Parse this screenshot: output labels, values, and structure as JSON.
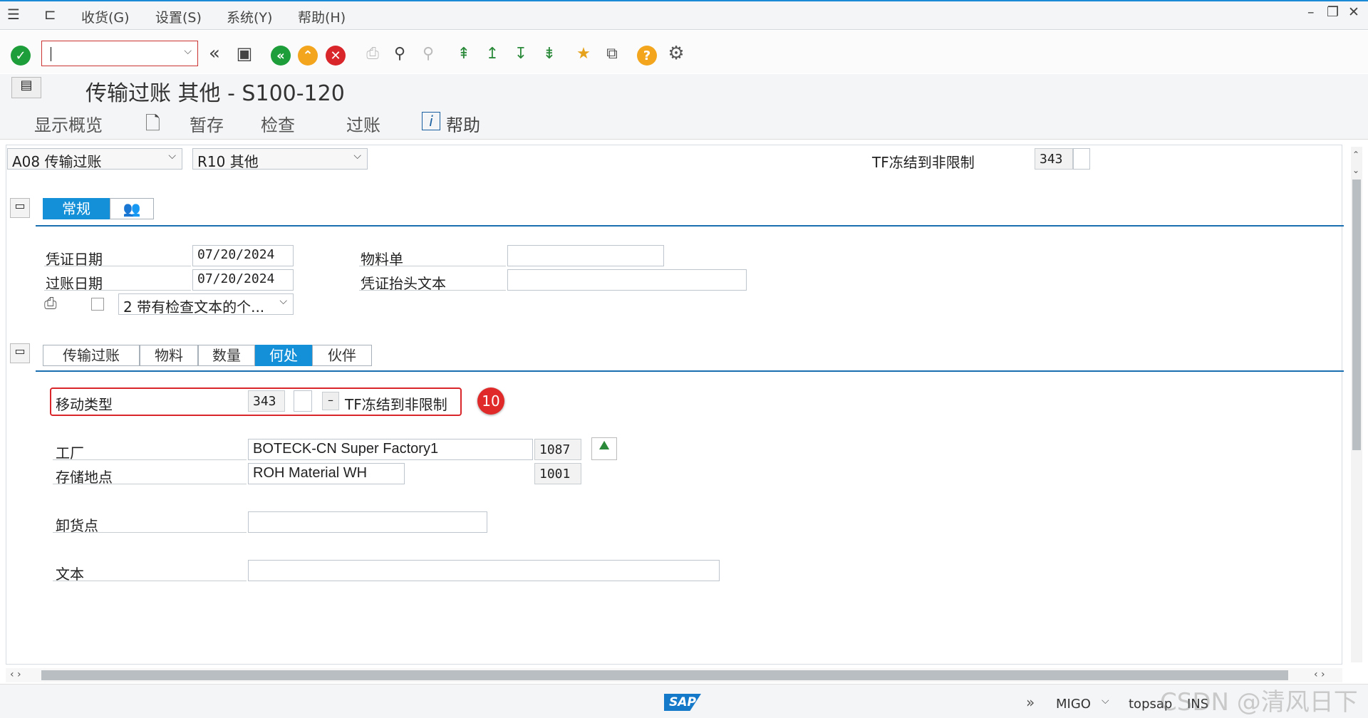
{
  "menu": {
    "items": [
      "收货(G)",
      "设置(S)",
      "系统(Y)",
      "帮助(H)"
    ]
  },
  "title": "传输过账 其他 - S100-120",
  "app_toolbar": {
    "overview": "显示概览",
    "hold": "暂存",
    "check": "检查",
    "post": "过账",
    "help": "帮助"
  },
  "header": {
    "action_select": "A08 传输过账",
    "ref_select": "R10 其他",
    "mvt_label": "TF冻结到非限制",
    "mvt_value": "343"
  },
  "tabs_top": {
    "general": "常规"
  },
  "general": {
    "doc_date_label": "凭证日期",
    "doc_date": "07/20/2024",
    "post_date_label": "过账日期",
    "post_date": "07/20/2024",
    "material_slip_label": "物料单",
    "header_text_label": "凭证抬头文本",
    "print_option": "2 带有检查文本的个..."
  },
  "tabs_item": [
    "传输过账",
    "物料",
    "数量",
    "何处",
    "伙伴"
  ],
  "where": {
    "movement_type_label": "移动类型",
    "movement_type": "343",
    "movement_desc": "TF冻结到非限制",
    "minus": "–",
    "badge": "10",
    "plant_label": "工厂",
    "plant_name": "BOTECK-CN Super Factory1",
    "plant_code": "1087",
    "sloc_label": "存储地点",
    "sloc_name": "ROH Material WH",
    "sloc_code": "1001",
    "unloading_label": "卸货点",
    "text_label": "文本"
  },
  "status": {
    "brand": "SAP",
    "tcode": "MIGO",
    "server": "topsap",
    "mode": "INS",
    "watermark": "CSDN @清风日下"
  },
  "colors": {
    "accent": "#1390d8",
    "highlight": "#d9262b",
    "green": "#1e9e3a",
    "orange": "#f2a51d"
  }
}
